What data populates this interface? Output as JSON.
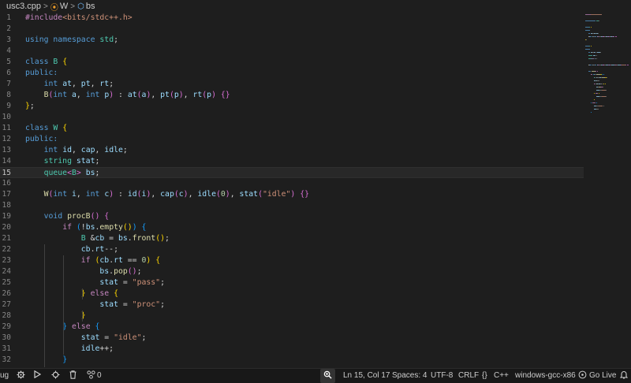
{
  "breadcrumb": {
    "file": "usc3.cpp",
    "class": "W",
    "member": "bs"
  },
  "lines": [
    {
      "n": "1",
      "s": [
        {
          "t": "#include",
          "c": "pre"
        },
        {
          "t": "<bits/stdc++.h>",
          "c": "inc"
        }
      ]
    },
    {
      "n": "2",
      "s": []
    },
    {
      "n": "3",
      "s": [
        {
          "t": "using",
          "c": "kw"
        },
        {
          "t": " "
        },
        {
          "t": "namespace",
          "c": "kw"
        },
        {
          "t": " "
        },
        {
          "t": "std",
          "c": "ty"
        },
        {
          "t": ";"
        }
      ]
    },
    {
      "n": "4",
      "s": []
    },
    {
      "n": "5",
      "s": [
        {
          "t": "class",
          "c": "kw"
        },
        {
          "t": " "
        },
        {
          "t": "B",
          "c": "ty"
        },
        {
          "t": " "
        },
        {
          "t": "{",
          "c": "p1"
        }
      ]
    },
    {
      "n": "6",
      "s": [
        {
          "t": "public:",
          "c": "kw"
        }
      ]
    },
    {
      "n": "7",
      "s": [
        {
          "t": "    "
        },
        {
          "t": "int",
          "c": "kw"
        },
        {
          "t": " "
        },
        {
          "t": "at",
          "c": "var"
        },
        {
          "t": ", "
        },
        {
          "t": "pt",
          "c": "var"
        },
        {
          "t": ", "
        },
        {
          "t": "rt",
          "c": "var"
        },
        {
          "t": ";"
        }
      ]
    },
    {
      "n": "8",
      "s": [
        {
          "t": "    "
        },
        {
          "t": "B",
          "c": "fn"
        },
        {
          "t": "(",
          "c": "p2"
        },
        {
          "t": "int",
          "c": "kw"
        },
        {
          "t": " "
        },
        {
          "t": "a",
          "c": "var"
        },
        {
          "t": ", "
        },
        {
          "t": "int",
          "c": "kw"
        },
        {
          "t": " "
        },
        {
          "t": "p",
          "c": "var"
        },
        {
          "t": ")",
          "c": "p2"
        },
        {
          "t": " : "
        },
        {
          "t": "at",
          "c": "var"
        },
        {
          "t": "(",
          "c": "p2"
        },
        {
          "t": "a",
          "c": "var"
        },
        {
          "t": ")",
          "c": "p2"
        },
        {
          "t": ", "
        },
        {
          "t": "pt",
          "c": "var"
        },
        {
          "t": "(",
          "c": "p2"
        },
        {
          "t": "p",
          "c": "var"
        },
        {
          "t": ")",
          "c": "p2"
        },
        {
          "t": ", "
        },
        {
          "t": "rt",
          "c": "var"
        },
        {
          "t": "(",
          "c": "p2"
        },
        {
          "t": "p",
          "c": "var"
        },
        {
          "t": ")",
          "c": "p2"
        },
        {
          "t": " "
        },
        {
          "t": "{}",
          "c": "p2"
        }
      ]
    },
    {
      "n": "9",
      "s": [
        {
          "t": "}",
          "c": "p1"
        },
        {
          "t": ";"
        }
      ]
    },
    {
      "n": "10",
      "s": []
    },
    {
      "n": "11",
      "s": [
        {
          "t": "class",
          "c": "kw"
        },
        {
          "t": " "
        },
        {
          "t": "W",
          "c": "ty"
        },
        {
          "t": " "
        },
        {
          "t": "{",
          "c": "p1"
        }
      ]
    },
    {
      "n": "12",
      "s": [
        {
          "t": "public:",
          "c": "kw"
        }
      ]
    },
    {
      "n": "13",
      "s": [
        {
          "t": "    "
        },
        {
          "t": "int",
          "c": "kw"
        },
        {
          "t": " "
        },
        {
          "t": "id",
          "c": "var"
        },
        {
          "t": ", "
        },
        {
          "t": "cap",
          "c": "var"
        },
        {
          "t": ", "
        },
        {
          "t": "idle",
          "c": "var"
        },
        {
          "t": ";"
        }
      ]
    },
    {
      "n": "14",
      "s": [
        {
          "t": "    "
        },
        {
          "t": "string",
          "c": "ty"
        },
        {
          "t": " "
        },
        {
          "t": "stat",
          "c": "var"
        },
        {
          "t": ";"
        }
      ]
    },
    {
      "n": "15",
      "s": [
        {
          "t": "    "
        },
        {
          "t": "queue",
          "c": "ty"
        },
        {
          "t": "<",
          "c": "p2"
        },
        {
          "t": "B",
          "c": "ty"
        },
        {
          "t": ">",
          "c": "p2"
        },
        {
          "t": " "
        },
        {
          "t": "bs",
          "c": "var"
        },
        {
          "t": ";"
        }
      ],
      "current": true
    },
    {
      "n": "16",
      "s": []
    },
    {
      "n": "17",
      "s": [
        {
          "t": "    "
        },
        {
          "t": "W",
          "c": "fn"
        },
        {
          "t": "(",
          "c": "p2"
        },
        {
          "t": "int",
          "c": "kw"
        },
        {
          "t": " "
        },
        {
          "t": "i",
          "c": "var"
        },
        {
          "t": ", "
        },
        {
          "t": "int",
          "c": "kw"
        },
        {
          "t": " "
        },
        {
          "t": "c",
          "c": "var"
        },
        {
          "t": ")",
          "c": "p2"
        },
        {
          "t": " : "
        },
        {
          "t": "id",
          "c": "var"
        },
        {
          "t": "(",
          "c": "p2"
        },
        {
          "t": "i",
          "c": "var"
        },
        {
          "t": ")",
          "c": "p2"
        },
        {
          "t": ", "
        },
        {
          "t": "cap",
          "c": "var"
        },
        {
          "t": "(",
          "c": "p2"
        },
        {
          "t": "c",
          "c": "var"
        },
        {
          "t": ")",
          "c": "p2"
        },
        {
          "t": ", "
        },
        {
          "t": "idle",
          "c": "var"
        },
        {
          "t": "(",
          "c": "p2"
        },
        {
          "t": "0",
          "c": "num"
        },
        {
          "t": ")",
          "c": "p2"
        },
        {
          "t": ", "
        },
        {
          "t": "stat",
          "c": "var"
        },
        {
          "t": "(",
          "c": "p2"
        },
        {
          "t": "\"idle\"",
          "c": "str"
        },
        {
          "t": ")",
          "c": "p2"
        },
        {
          "t": " "
        },
        {
          "t": "{}",
          "c": "p2"
        }
      ]
    },
    {
      "n": "18",
      "s": []
    },
    {
      "n": "19",
      "s": [
        {
          "t": "    "
        },
        {
          "t": "void",
          "c": "kw"
        },
        {
          "t": " "
        },
        {
          "t": "procB",
          "c": "fn"
        },
        {
          "t": "()",
          "c": "p2"
        },
        {
          "t": " "
        },
        {
          "t": "{",
          "c": "p2"
        }
      ]
    },
    {
      "n": "20",
      "s": [
        {
          "t": "        "
        },
        {
          "t": "if",
          "c": "ctl"
        },
        {
          "t": " "
        },
        {
          "t": "(",
          "c": "p3"
        },
        {
          "t": "!"
        },
        {
          "t": "bs",
          "c": "var"
        },
        {
          "t": "."
        },
        {
          "t": "empty",
          "c": "fn"
        },
        {
          "t": "()",
          "c": "p1"
        },
        {
          "t": ")",
          "c": "p3"
        },
        {
          "t": " "
        },
        {
          "t": "{",
          "c": "p3"
        }
      ]
    },
    {
      "n": "21",
      "s": [
        {
          "t": "            "
        },
        {
          "t": "B",
          "c": "ty"
        },
        {
          "t": " &"
        },
        {
          "t": "cb",
          "c": "var"
        },
        {
          "t": " = "
        },
        {
          "t": "bs",
          "c": "var"
        },
        {
          "t": "."
        },
        {
          "t": "front",
          "c": "fn"
        },
        {
          "t": "()",
          "c": "p1"
        },
        {
          "t": ";"
        }
      ]
    },
    {
      "n": "22",
      "s": [
        {
          "t": "            "
        },
        {
          "t": "cb",
          "c": "var"
        },
        {
          "t": "."
        },
        {
          "t": "rt",
          "c": "var"
        },
        {
          "t": "--;"
        }
      ]
    },
    {
      "n": "23",
      "s": [
        {
          "t": "            "
        },
        {
          "t": "if",
          "c": "ctl"
        },
        {
          "t": " "
        },
        {
          "t": "(",
          "c": "p1"
        },
        {
          "t": "cb",
          "c": "var"
        },
        {
          "t": "."
        },
        {
          "t": "rt",
          "c": "var"
        },
        {
          "t": " == "
        },
        {
          "t": "0",
          "c": "num"
        },
        {
          "t": ")",
          "c": "p1"
        },
        {
          "t": " "
        },
        {
          "t": "{",
          "c": "p1"
        }
      ]
    },
    {
      "n": "24",
      "s": [
        {
          "t": "                "
        },
        {
          "t": "bs",
          "c": "var"
        },
        {
          "t": "."
        },
        {
          "t": "pop",
          "c": "fn"
        },
        {
          "t": "()",
          "c": "p2"
        },
        {
          "t": ";"
        }
      ]
    },
    {
      "n": "25",
      "s": [
        {
          "t": "                "
        },
        {
          "t": "stat",
          "c": "var"
        },
        {
          "t": " = "
        },
        {
          "t": "\"pass\"",
          "c": "str"
        },
        {
          "t": ";"
        }
      ]
    },
    {
      "n": "26",
      "s": [
        {
          "t": "            "
        },
        {
          "t": "}",
          "c": "p1"
        },
        {
          "t": " "
        },
        {
          "t": "else",
          "c": "ctl"
        },
        {
          "t": " "
        },
        {
          "t": "{",
          "c": "p1"
        }
      ]
    },
    {
      "n": "27",
      "s": [
        {
          "t": "                "
        },
        {
          "t": "stat",
          "c": "var"
        },
        {
          "t": " = "
        },
        {
          "t": "\"proc\"",
          "c": "str"
        },
        {
          "t": ";"
        }
      ]
    },
    {
      "n": "28",
      "s": [
        {
          "t": "            "
        },
        {
          "t": "}",
          "c": "p1"
        }
      ]
    },
    {
      "n": "29",
      "s": [
        {
          "t": "        "
        },
        {
          "t": "}",
          "c": "p3"
        },
        {
          "t": " "
        },
        {
          "t": "else",
          "c": "ctl"
        },
        {
          "t": " "
        },
        {
          "t": "{",
          "c": "p3"
        }
      ]
    },
    {
      "n": "30",
      "s": [
        {
          "t": "            "
        },
        {
          "t": "stat",
          "c": "var"
        },
        {
          "t": " = "
        },
        {
          "t": "\"idle\"",
          "c": "str"
        },
        {
          "t": ";"
        }
      ]
    },
    {
      "n": "31",
      "s": [
        {
          "t": "            "
        },
        {
          "t": "idle",
          "c": "var"
        },
        {
          "t": "++;"
        }
      ]
    },
    {
      "n": "32",
      "s": [
        {
          "t": "        "
        },
        {
          "t": "}",
          "c": "p3"
        }
      ]
    }
  ],
  "statusbar": {
    "debug": "ug",
    "ports": "0",
    "position": "Ln 15, Col 17",
    "spaces": "Spaces: 4",
    "encoding": "UTF-8",
    "eol": "CRLF",
    "language": "C++",
    "compiler": "windows-gcc-x86",
    "golive": "Go Live"
  }
}
